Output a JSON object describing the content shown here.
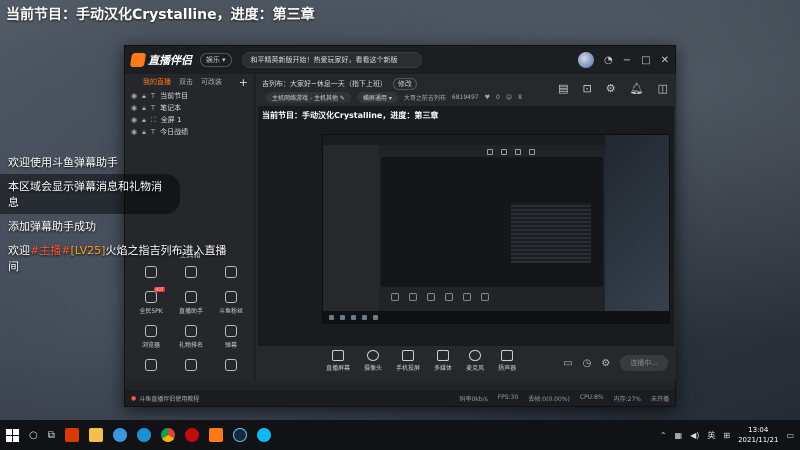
{
  "overlay": {
    "stream_title": "当前节目：手动汉化Crystalline，进度：第三章"
  },
  "app": {
    "logo_text": "直播伴侣",
    "mode_label": "娱乐",
    "notice": "和平精英新版开始！热爱玩家好，看看这个新版",
    "left_tabs": [
      "我的直播",
      "双击",
      "可改装"
    ],
    "sources": [
      "当前节目",
      "笔记本",
      "全屏 1",
      "今日战绩"
    ],
    "tools_title": "工具箱",
    "tools": [
      {
        "label": "",
        "hot": ""
      },
      {
        "label": "",
        "hot": ""
      },
      {
        "label": "",
        "hot": ""
      },
      {
        "label": "全民5PK",
        "hot": "HOT"
      },
      {
        "label": "直播助手",
        "hot": ""
      },
      {
        "label": "斗鱼粉丝",
        "hot": ""
      },
      {
        "label": "浏览器",
        "hot": ""
      },
      {
        "label": "礼物排名",
        "hot": ""
      },
      {
        "label": "弹幕",
        "hot": ""
      },
      {
        "label": "",
        "hot": ""
      },
      {
        "label": "",
        "hot": ""
      },
      {
        "label": "",
        "hot": ""
      }
    ],
    "room_name": "吉列布：大家好~休息一天（指下上班）",
    "room_edit": "修改",
    "category": "主机网络游戏 - 主机其他",
    "live_type": "横屏通用",
    "room_id": "大哥之前吉列布",
    "viewers": "6819497",
    "likes": "0",
    "fans": "8",
    "preview_title": "当前节目：手动汉化Crystalline，进度：第三章",
    "controls": [
      "直播屏幕",
      "摄像头",
      "手机投屏",
      "多媒体",
      "麦克风",
      "扬声器"
    ],
    "live_button": "连播中...",
    "help_text": "斗鱼直播伴侣使用教程",
    "stats": [
      "码率0kb/s",
      "FPS:30",
      "丢帧:0(0.00%)",
      "CPU:8%",
      "内存:27%",
      "未开播"
    ]
  },
  "danmaku": {
    "line1": "欢迎使用斗鱼弹幕助手",
    "line2": "本区域会显示弹幕消息和礼物消息",
    "line3": "添加弹幕助手成功",
    "line4_prefix": "欢迎",
    "line4_tag": "#主播#",
    "line4_level": "[LV25]",
    "line4_rest": "火焰之指吉列布进入直播间"
  },
  "taskbar": {
    "lang": "英",
    "time": "13:04",
    "date": "2021/11/21"
  },
  "colors": {
    "accent": "#ff7a1a",
    "danmaku_highlight": "#ff5a3c"
  }
}
